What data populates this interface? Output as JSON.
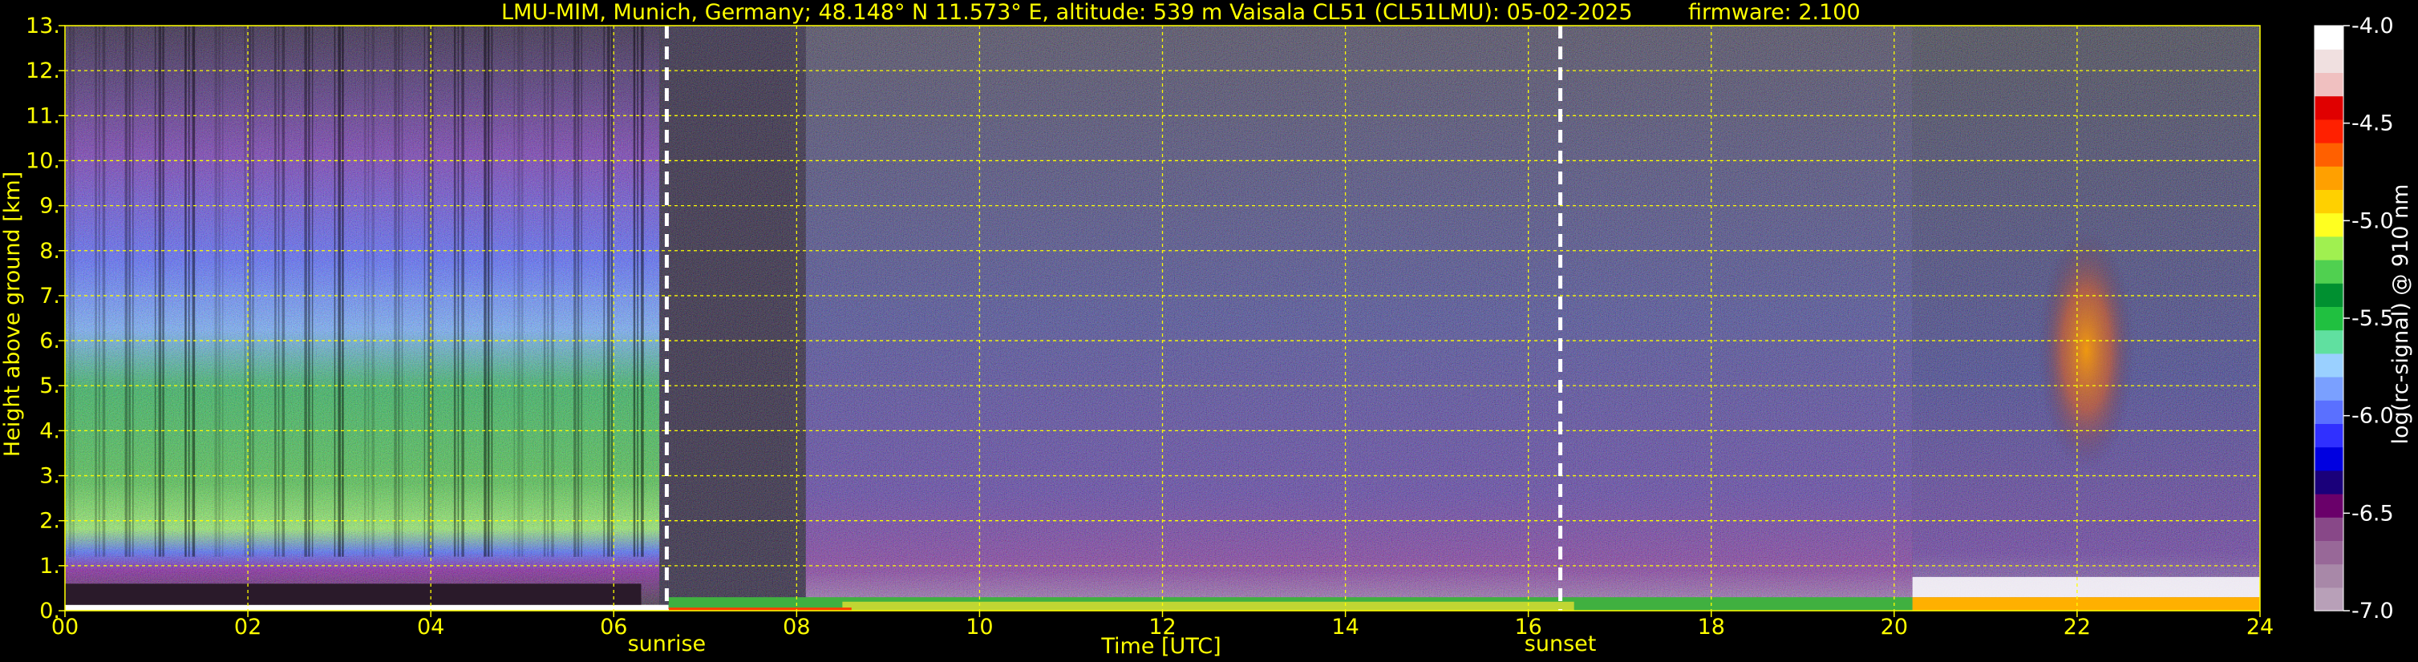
{
  "chart_data": {
    "type": "heatmap",
    "title_left": "LMU-MIM, Munich, Germany; 48.148° N 11.573° E, altitude: 539 m",
    "title_mid": "Vaisala CL51 (CL51LMU): 05-02-2025",
    "title_right": "firmware: 2.100",
    "xlabel": "Time [UTC]",
    "ylabel": "Height above ground [km]",
    "xlim": [
      0,
      24
    ],
    "ylim": [
      0,
      13
    ],
    "x_ticks": [
      0,
      2,
      4,
      6,
      8,
      10,
      12,
      14,
      16,
      18,
      20,
      22,
      24
    ],
    "x_tick_labels": [
      "00",
      "02",
      "04",
      "06",
      "08",
      "10",
      "12",
      "14",
      "16",
      "18",
      "20",
      "22",
      "24"
    ],
    "y_ticks": [
      0,
      1,
      2,
      3,
      4,
      5,
      6,
      7,
      8,
      9,
      10,
      11,
      12,
      13
    ],
    "y_tick_labels": [
      "0.",
      "1.",
      "2.",
      "3.",
      "4.",
      "5.",
      "6.",
      "7.",
      "8.",
      "9.",
      "10.",
      "11.",
      "12.",
      "13."
    ],
    "grid": true,
    "markers": [
      {
        "label": "sunrise",
        "x": 6.58
      },
      {
        "label": "sunset",
        "x": 16.35
      }
    ],
    "colorbar": {
      "label": "log(rc-signal) @ 910 nm",
      "range": [
        -7.0,
        -4.0
      ],
      "ticks": [
        -4.0,
        -4.5,
        -5.0,
        -5.5,
        -6.0,
        -6.5,
        -7.0
      ],
      "tick_labels": [
        "-4.0",
        "-4.5",
        "-5.0",
        "-5.5",
        "-6.0",
        "-6.5",
        "-7.0"
      ],
      "colors": [
        "#b8a0b8",
        "#a888a8",
        "#986898",
        "#884888",
        "#6a006a",
        "#1a007a",
        "#0000e0",
        "#3030ff",
        "#5a70ff",
        "#7aa0ff",
        "#9ad0ff",
        "#60e0a0",
        "#20c040",
        "#009030",
        "#50d050",
        "#a0f050",
        "#ffff20",
        "#ffd000",
        "#ffa000",
        "#ff6000",
        "#ff2000",
        "#e00000",
        "#f0c0c0",
        "#f0e0e0",
        "#ffffff"
      ]
    },
    "palette": {
      "text": "#ffff00",
      "grid": "#ffff00",
      "background": "#000000"
    }
  }
}
